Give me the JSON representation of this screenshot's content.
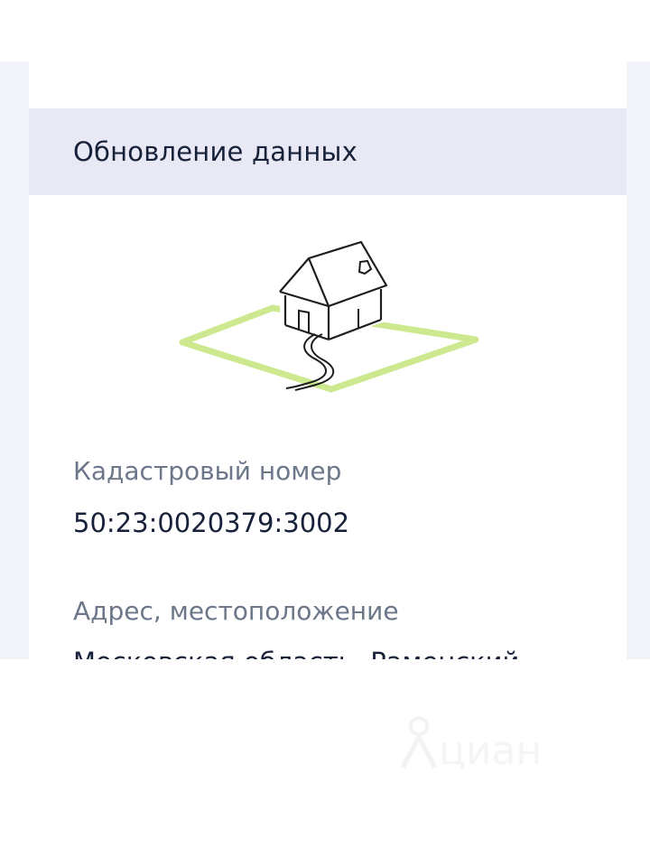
{
  "section": {
    "title": "Обновление данных"
  },
  "fields": {
    "cadastral_label": "Кадастровый номер",
    "cadastral_value": "50:23:0020379:3002",
    "address_label": "Адрес, местоположение",
    "address_value_partial": "Московская область, Раменский"
  },
  "watermark": {
    "text": "циан"
  },
  "colors": {
    "header_bg": "#e8e9f4",
    "page_bg": "#f2f4fa",
    "text_primary": "#17213a",
    "text_secondary": "#6c778a",
    "plot_green": "#cde98f"
  },
  "icons": {
    "illustration": "house-on-plot-icon",
    "watermark": "cian-logo-icon"
  }
}
